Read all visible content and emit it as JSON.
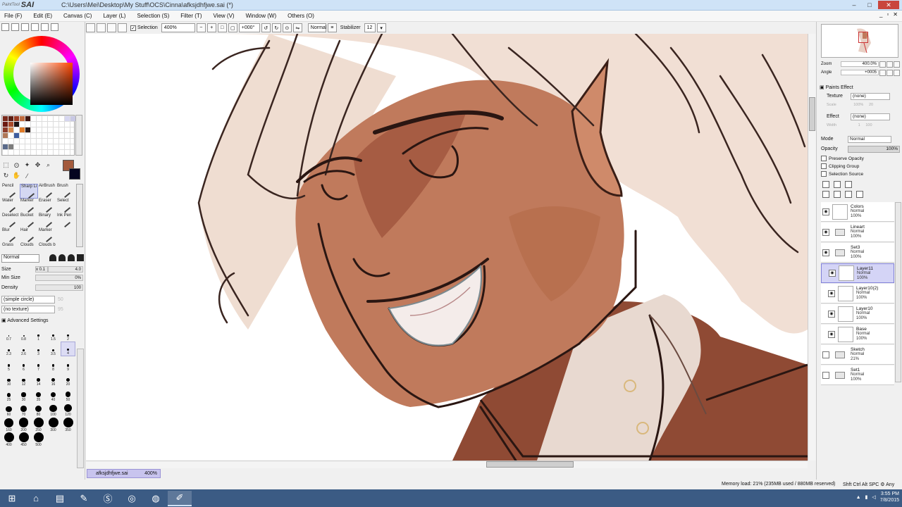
{
  "window": {
    "app_name": "SAI",
    "app_prefix": "PaintTool",
    "title": "C:\\Users\\Mei\\Desktop\\My Stuff\\OCS\\Cinna\\afksjdhfjwe.sai (*)",
    "minimize": "–",
    "maximize": "□",
    "close": "✕"
  },
  "menu": [
    {
      "label": "File (F)"
    },
    {
      "label": "Edit (E)"
    },
    {
      "label": "Canvas (C)"
    },
    {
      "label": "Layer (L)"
    },
    {
      "label": "Selection (S)"
    },
    {
      "label": "Filter (T)"
    },
    {
      "label": "View (V)"
    },
    {
      "label": "Window (W)"
    },
    {
      "label": "Others (O)"
    }
  ],
  "toolbar": {
    "selection_label": "Selection",
    "zoom": "400%",
    "angle": "+000°",
    "blend_mode": "Normal",
    "stabilizer_label": "Stabilizer",
    "stabilizer_value": "12"
  },
  "colors": {
    "foreground": "#a35a3c",
    "background": "#050520"
  },
  "tools": [
    {
      "label": "Pencil"
    },
    {
      "label": "Sharp Li"
    },
    {
      "label": "AirBrush"
    },
    {
      "label": "Brush"
    },
    {
      "label": "Water"
    },
    {
      "label": "Marker"
    },
    {
      "label": "Eraser"
    },
    {
      "label": "Select"
    },
    {
      "label": "Deselect"
    },
    {
      "label": "Bucket"
    },
    {
      "label": "Binary"
    },
    {
      "label": "Ink Pen"
    },
    {
      "label": "Blur"
    },
    {
      "label": "Hair"
    },
    {
      "label": "Marker"
    },
    {
      "label": ""
    },
    {
      "label": "Grass"
    },
    {
      "label": "Clouds"
    },
    {
      "label": "Clouds b"
    },
    {
      "label": ""
    }
  ],
  "brush": {
    "mode": "Normal",
    "size_label": "Size",
    "size_mult": "x 0.1",
    "size_value": "4.0",
    "min_size_label": "Min Size",
    "min_size_value": "0%",
    "density_label": "Density",
    "density_value": "100",
    "shape": "(simple circle)",
    "shape_value": "50",
    "texture": "(no texture)",
    "texture_value": "95",
    "advanced": "Advanced Settings"
  },
  "brush_sizes": [
    "0.7",
    "0.8",
    "1",
    "1.5",
    "2",
    "2.3",
    "2.6",
    "3",
    "3.5",
    "4",
    "5",
    "6",
    "7",
    "8",
    "9",
    "10",
    "12",
    "14",
    "16",
    "20",
    "25",
    "30",
    "35",
    "40",
    "50",
    "60",
    "70",
    "80",
    "100",
    "120",
    "160",
    "200",
    "250",
    "300",
    "350",
    "400",
    "450",
    "500"
  ],
  "navigator": {
    "zoom_label": "Zoom",
    "zoom_value": "400.0%",
    "angle_label": "Angle",
    "angle_value": "+0005"
  },
  "paints_effect": {
    "header": "Paints Effect",
    "texture_label": "Texture",
    "texture_value": "(none)",
    "scale_label": "Scale",
    "scale_value": "100%",
    "scale_num": "20",
    "effect_label": "Effect",
    "effect_value": "(none)",
    "width_label": "Width",
    "width_value": "1",
    "width_num": "100"
  },
  "layer_props": {
    "mode_label": "Mode",
    "mode_value": "Normal",
    "opacity_label": "Opacity",
    "opacity_value": "100%",
    "preserve_opacity": "Preserve Opacity",
    "clipping_group": "Clipping Group",
    "selection_source": "Selection Source"
  },
  "layers": [
    {
      "name": "Colors",
      "mode": "Normal",
      "opacity": "100%"
    },
    {
      "name": "Lineart",
      "mode": "Normal",
      "opacity": "100%"
    },
    {
      "name": "Set3",
      "mode": "Normal",
      "opacity": "100%"
    },
    {
      "name": "Layer11",
      "mode": "Normal",
      "opacity": "100%"
    },
    {
      "name": "Layer10(2)",
      "mode": "Normal",
      "opacity": "100%"
    },
    {
      "name": "Layer10",
      "mode": "Normal",
      "opacity": "100%"
    },
    {
      "name": "Base",
      "mode": "Normal",
      "opacity": "100%"
    },
    {
      "name": "Sketch",
      "mode": "Normal",
      "opacity": "21%"
    },
    {
      "name": "Set1",
      "mode": "Normal",
      "opacity": "100%"
    }
  ],
  "document_tab": {
    "name": "afksjdhfjwe.sai",
    "zoom": "400%"
  },
  "status": {
    "memory": "Memory load: 21% (235MB used / 880MB reserved)",
    "keys": "Shft Ctrl Alt SPC ⚙ Any"
  },
  "taskbar": {
    "time": "3:55 PM",
    "date": "7/8/2015"
  }
}
